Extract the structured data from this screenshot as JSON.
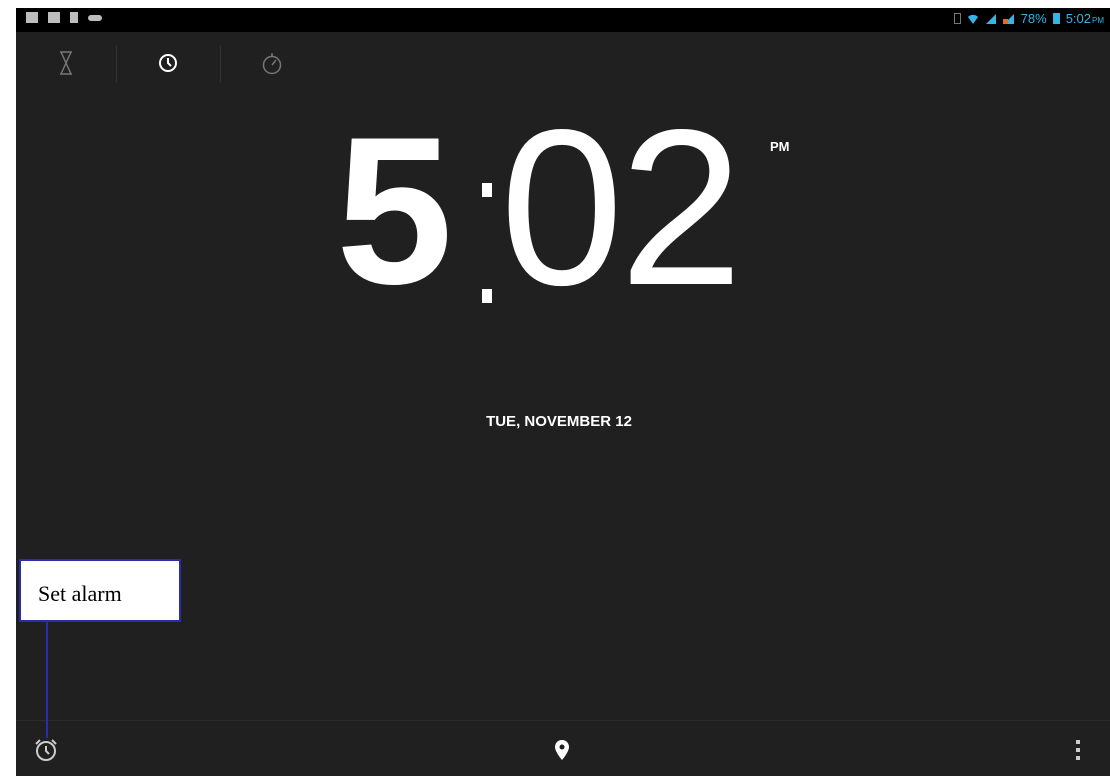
{
  "status_bar": {
    "battery_percent": "78%",
    "time": "5:02",
    "time_suffix": "PM"
  },
  "tabs": [
    "timer-icon",
    "clock-icon",
    "stopwatch-icon"
  ],
  "clock": {
    "hour": "5",
    "minutes": "02",
    "ampm": "PM"
  },
  "date": "TUE, NOVEMBER 12",
  "bottom_bar": {
    "icons": [
      "alarm-icon",
      "location-icon",
      "overflow-menu-icon"
    ]
  },
  "annotation": {
    "label": "Set alarm",
    "border_color": "#2b2bb0"
  },
  "colors": {
    "background": "#202020",
    "status_accent": "#33b5e5"
  }
}
